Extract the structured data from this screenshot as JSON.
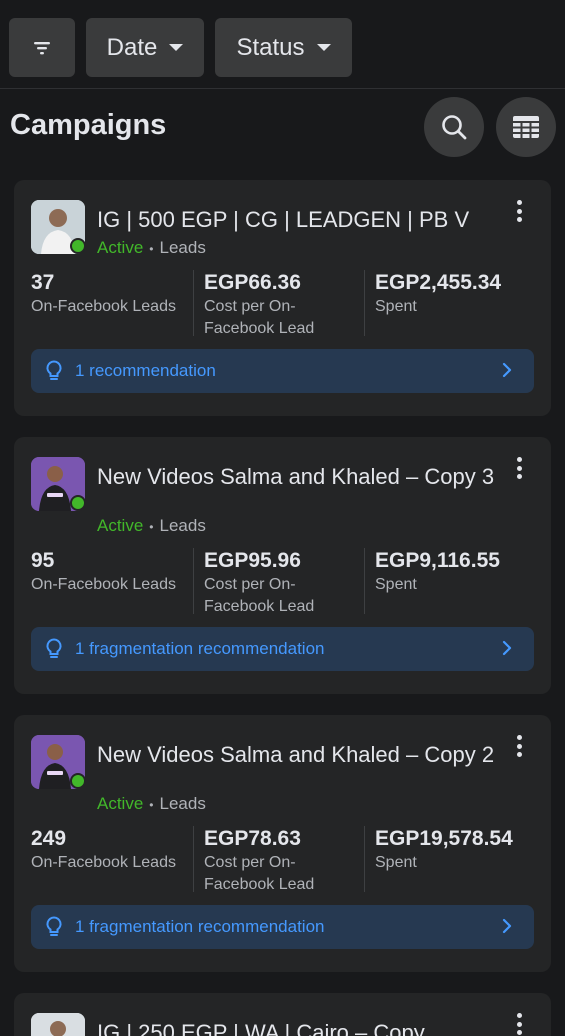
{
  "filters": {
    "date_label": "Date",
    "status_label": "Status"
  },
  "header": {
    "title": "Campaigns"
  },
  "campaigns": [
    {
      "name": "IG | 500 EGP | CG | LEADGEN | PB V",
      "status": "Active",
      "objective": "Leads",
      "results_value": "37",
      "results_label": "On-Facebook Leads",
      "cost_value": "EGP66.36",
      "cost_label_1": "Cost per On-",
      "cost_label_2": "Facebook Lead",
      "spent_value": "EGP2,455.34",
      "spent_label": "Spent",
      "recommendation": "1 recommendation"
    },
    {
      "name": "New Videos Salma and Khaled – Copy 3",
      "status": "Active",
      "objective": "Leads",
      "results_value": "95",
      "results_label": "On-Facebook Leads",
      "cost_value": "EGP95.96",
      "cost_label_1": "Cost per On-",
      "cost_label_2": "Facebook Lead",
      "spent_value": "EGP9,116.55",
      "spent_label": "Spent",
      "recommendation": "1 fragmentation recommendation"
    },
    {
      "name": "New Videos Salma and Khaled – Copy 2",
      "status": "Active",
      "objective": "Leads",
      "results_value": "249",
      "results_label": "On-Facebook Leads",
      "cost_value": "EGP78.63",
      "cost_label_1": "Cost per On-",
      "cost_label_2": "Facebook Lead",
      "spent_value": "EGP19,578.54",
      "spent_label": "Spent",
      "recommendation": "1 fragmentation recommendation"
    },
    {
      "name": "IG | 250 EGP | WA | Cairo – Copy"
    }
  ],
  "colors": {
    "background": "#18191b",
    "card": "#242526",
    "active_green": "#42b72a",
    "link_blue": "#4599ff",
    "recommendation_bg": "#263951"
  },
  "icons": {
    "filter": "filter-icon",
    "search": "search-icon",
    "table": "table-icon",
    "more": "more-vertical-icon",
    "bulb": "lightbulb-icon",
    "chevron": "chevron-right-icon"
  }
}
